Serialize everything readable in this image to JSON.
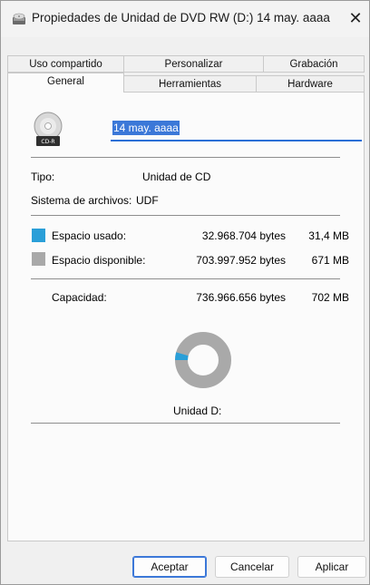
{
  "window": {
    "title": "Propiedades de Unidad de DVD RW (D:) 14 may. aaaa",
    "close_glyph": "✕"
  },
  "tabs": {
    "row1": [
      "Uso compartido",
      "Personalizar",
      "Grabación"
    ],
    "row2": [
      "General",
      "Herramientas",
      "Hardware"
    ],
    "active": "General"
  },
  "general": {
    "drive_name": "14 may. aaaa",
    "icon_label": "CD-R",
    "type_label": "Tipo:",
    "type_value": "Unidad de CD",
    "fs_label": "Sistema de archivos:",
    "fs_value": "UDF",
    "used": {
      "label": "Espacio usado:",
      "bytes": "32.968.704 bytes",
      "size": "31,4 MB",
      "color": "#2a9fd8"
    },
    "free": {
      "label": "Espacio disponible:",
      "bytes": "703.997.952 bytes",
      "size": "671 MB",
      "color": "#a9a9a9"
    },
    "capacity": {
      "label": "Capacidad:",
      "bytes": "736.966.656 bytes",
      "size": "702 MB"
    },
    "used_fraction": 0.0447,
    "drive_label": "Unidad D:"
  },
  "buttons": {
    "ok": "Aceptar",
    "cancel": "Cancelar",
    "apply": "Aplicar"
  }
}
